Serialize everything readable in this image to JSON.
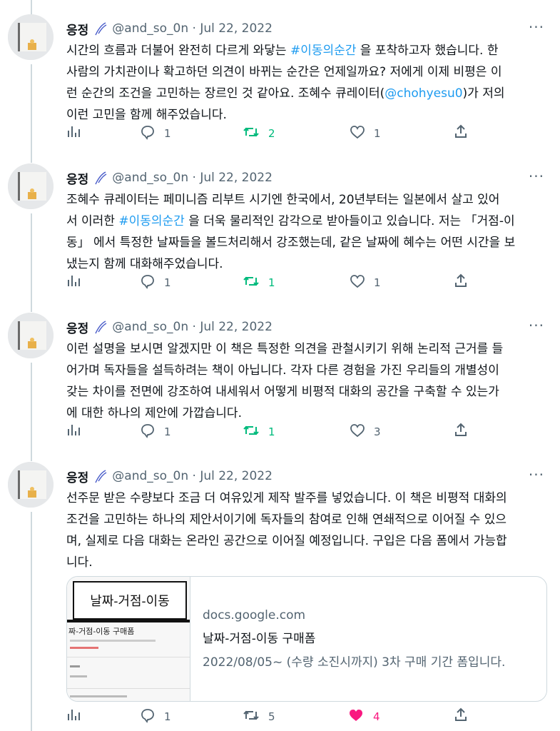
{
  "author": {
    "name": "응정",
    "handle_date": "@and_so_0n · Jul 22, 2022"
  },
  "more_icon": "more-dots-icon",
  "colors": {
    "link": "#1d9bf0",
    "retweet": "#00ba7c",
    "like": "#f91880",
    "muted": "#536471"
  },
  "tweets": [
    {
      "text_before": "시간의 흐름과 더불어 완전히 다르게 와닿는 ",
      "hashtag": "#이동의순간",
      "text_mid": " 을 포착하고자 했습니다. 한\n사람의 가치관이나 확고하던 의견이 바뀌는 순간은 언제일까요? 저에게 이제 비평은 이\n런 순간의 조건을 고민하는 장르인 것 같아요. 조혜수 큐레이터(",
      "mention": "@chohyesu0",
      "text_after": ")가 저의\n이런 고민을 함께 해주었습니다.",
      "replies": "1",
      "retweets": "2",
      "likes": "1"
    },
    {
      "text_before": "조혜수 큐레이터는 페미니즘 리부트 시기엔 한국에서, 20년부터는 일본에서 살고 있어\n서 이러한 ",
      "hashtag": "#이동의순간",
      "text_after": " 을 더욱 물리적인 감각으로 받아들이고 있습니다. 저는 「거점-이\n동」 에서 특정한 날짜들을 볼드처리해서 강조했는데, 같은 날짜에 혜수는 어떤 시간을 보\n냈는지 함께 대화해주었습니다.",
      "replies": "1",
      "retweets": "1",
      "likes": "1"
    },
    {
      "text": "이런 설명을 보시면 알겠지만 이 책은 특정한 의견을 관철시키기 위해 논리적 근거를 들\n어가며 독자들을 설득하려는 책이 아닙니다. 각자 다른 경험을 가진 우리들의 개별성이\n갖는 차이를 전면에 강조하여 내세워서 어떻게 비평적 대화의 공간을 구축할 수 있는가\n에 대한 하나의 제안에 가깝습니다.",
      "replies": "1",
      "retweets": "1",
      "likes": "3"
    },
    {
      "text": "선주문 받은 수량보다 조금 더 여유있게 제작 발주를 넣었습니다. 이 책은 비평적 대화의\n조건을 고민하는 하나의 제안서이기에 독자들의 참여로 인해 연쇄적으로 이어질 수 있으\n며, 실제로 다음 대화는 온라인 공간으로 이어질 예정입니다. 구입은 다음 폼에서 가능합\n니다.",
      "card": {
        "thumb_title": "날짜-거점-이동",
        "thumb_form_title": "짜-거점-이동 구매폼",
        "domain": "docs.google.com",
        "title": "날짜-거점-이동 구매폼",
        "description": "2022/08/05~ (수량 소진시까지) 3차 구매 기간 폼입니다."
      },
      "replies": "1",
      "retweets": "5",
      "likes": "4"
    }
  ]
}
